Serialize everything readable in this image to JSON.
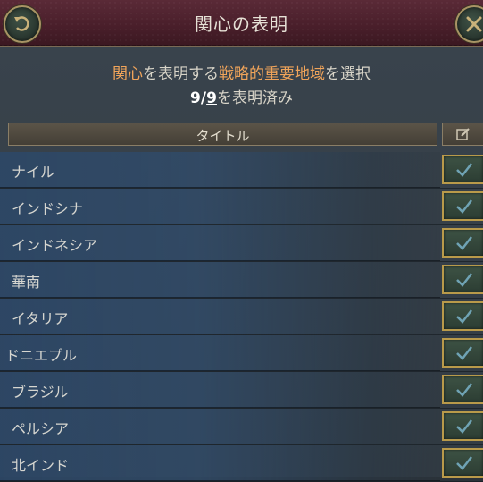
{
  "window": {
    "title": "関心の表明"
  },
  "instructions": {
    "line1_a": "関心",
    "line1_b": "を表明する",
    "line1_c": "戦略的重要地域",
    "line1_d": "を選択",
    "count_declared": "9",
    "separator": "/",
    "count_total": "9",
    "line2_suffix": "を表明済み"
  },
  "table": {
    "header_title": "タイトル",
    "rows": [
      {
        "label": "ナイル",
        "checked": true
      },
      {
        "label": "インドシナ",
        "checked": true
      },
      {
        "label": "インドネシア",
        "checked": true
      },
      {
        "label": "華南",
        "checked": true
      },
      {
        "label": "イタリア",
        "checked": true
      },
      {
        "label": "ドニエプル",
        "checked": true
      },
      {
        "label": "ブラジル",
        "checked": true
      },
      {
        "label": "ペルシア",
        "checked": true
      },
      {
        "label": "北インド",
        "checked": true
      }
    ]
  },
  "colors": {
    "highlight": "#f0a45a",
    "titlebar": "#4a1f2b",
    "checkbox_border": "#b99a4a",
    "checkmark": "#6fa3b4"
  },
  "icons": {
    "back": "undo-arrow-icon",
    "close": "close-x-icon",
    "header_check": "checkbox-edit-icon",
    "row_check": "checkmark-icon"
  }
}
